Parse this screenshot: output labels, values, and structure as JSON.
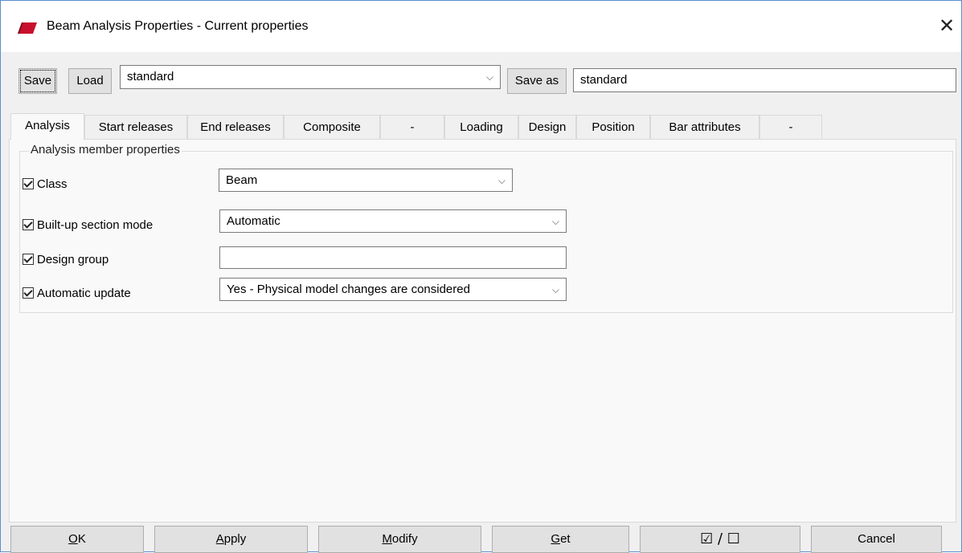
{
  "window": {
    "title": "Beam Analysis Properties - Current properties",
    "close_glyph": "✕",
    "app_icon": "tekla-icon",
    "accent_color": "#c8102e"
  },
  "toolbar": {
    "save_label": "Save",
    "load_label": "Load",
    "preset_value": "standard",
    "save_as_label": "Save as",
    "save_as_value": "standard"
  },
  "tabs": [
    {
      "label": "Analysis",
      "active": true
    },
    {
      "label": "Start releases"
    },
    {
      "label": "End releases"
    },
    {
      "label": "Composite"
    },
    {
      "label": "-"
    },
    {
      "label": "Loading"
    },
    {
      "label": "Design"
    },
    {
      "label": "Position"
    },
    {
      "label": "Bar attributes"
    },
    {
      "label": "-"
    }
  ],
  "group": {
    "title": "Analysis member properties",
    "rows": [
      {
        "label": "Class",
        "checked": true,
        "value": "Beam"
      },
      {
        "label": "Built-up section mode",
        "checked": true,
        "value": "Automatic"
      },
      {
        "label": "Design group",
        "checked": true,
        "value": ""
      },
      {
        "label": "Automatic update",
        "checked": true,
        "value": "Yes - Physical model changes are considered"
      }
    ]
  },
  "buttons": {
    "ok_key": "O",
    "ok_rest": "K",
    "apply_key": "A",
    "apply_rest": "pply",
    "modify_key": "M",
    "modify_rest": "odify",
    "get_key": "G",
    "get_rest": "et",
    "toggle_label": "☑ / ☐",
    "cancel_label": "Cancel"
  }
}
